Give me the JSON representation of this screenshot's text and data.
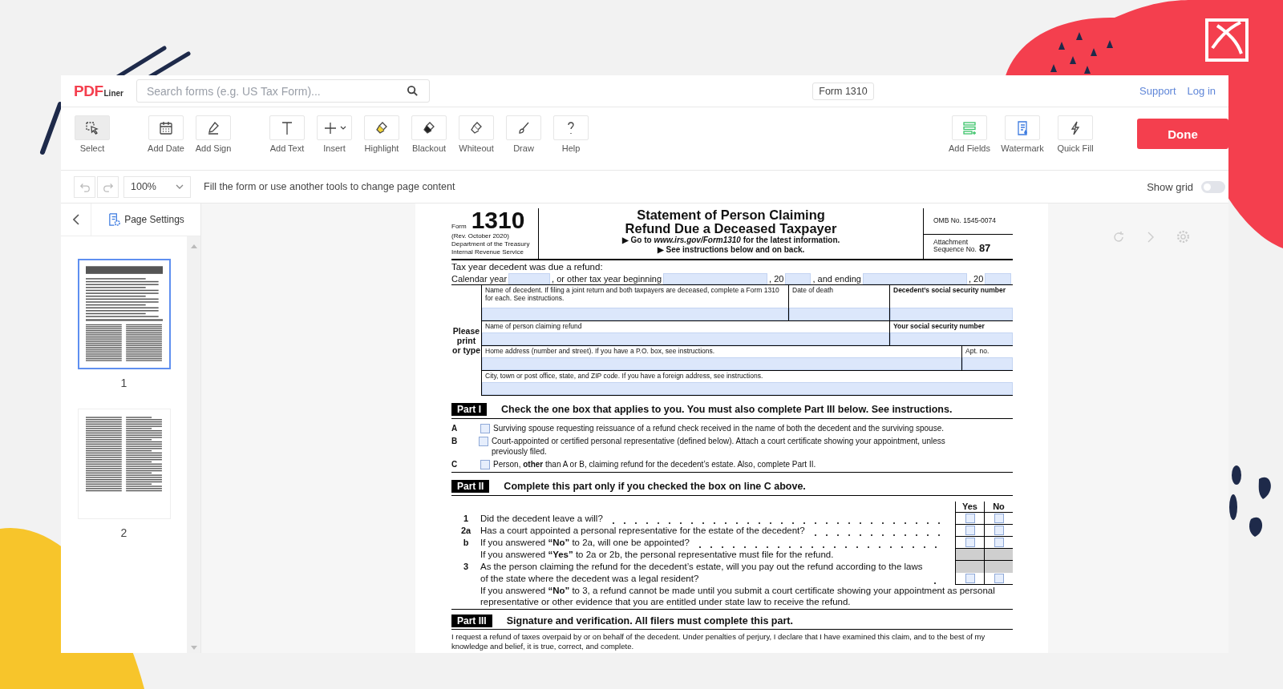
{
  "header": {
    "logo_main": "PDF",
    "logo_sub": "Liner",
    "search": {
      "placeholder": "Search forms (e.g. US Tax Form)..."
    },
    "document_title": "Form 1310",
    "links": [
      "Support",
      "Log in"
    ]
  },
  "toolbar": {
    "tool_groups": [
      [
        {
          "label": "Select",
          "kind": "select",
          "selected": true
        }
      ],
      [
        {
          "label": "Add Date",
          "kind": "calendar",
          "selected": false
        },
        {
          "label": "Add Sign",
          "kind": "sign",
          "selected": false
        }
      ],
      [
        {
          "label": "Add Text",
          "kind": "text",
          "selected": false
        },
        {
          "label": "Insert",
          "kind": "plus",
          "selected": false
        },
        {
          "label": "Highlight",
          "kind": "highlight",
          "selected": false
        },
        {
          "label": "Blackout",
          "kind": "blackout",
          "selected": false
        },
        {
          "label": "Whiteout",
          "kind": "whiteout",
          "selected": false
        },
        {
          "label": "Draw",
          "kind": "draw",
          "selected": false
        },
        {
          "label": "Help",
          "kind": "help",
          "selected": false
        }
      ]
    ],
    "right_tools": [
      {
        "label": "Add Fields",
        "kind": "fields",
        "selected": false
      },
      {
        "label": "Watermark",
        "kind": "watermark",
        "selected": false
      },
      {
        "label": "Quick Fill",
        "kind": "bolt",
        "selected": false
      }
    ],
    "done": "Done"
  },
  "subbar": {
    "zoom": "100%",
    "hint": "Fill the form or use another tools to change page content",
    "show_grid": {
      "label": "Show grid",
      "on": false
    }
  },
  "sidebar": {
    "page_settings": "Page Settings",
    "pages": [
      {
        "number": "1",
        "selected": true
      },
      {
        "number": "2",
        "selected": false
      }
    ]
  },
  "form": {
    "form_label": "Form",
    "number": "1310",
    "revision": "(Rev. October 2020)",
    "department": "Department of the Treasury",
    "service": "Internal Revenue Service",
    "title_lines": [
      "Statement of Person Claiming",
      "Refund Due a Deceased Taxpayer"
    ],
    "instructions": [
      "▶ Go to *www.irs.gov/Form1310* for the latest information.",
      "▶ See instructions below and on back."
    ],
    "omb": "OMB No. 1545-0074",
    "attachment": "Attachment",
    "sequence_label": "Sequence No.",
    "sequence": "87",
    "tax_year_heading": "Tax year decedent was due a refund:",
    "tax_year_labels": [
      "Calendar year",
      ", or other tax year beginning",
      ", 20",
      ", and ending",
      ", 20"
    ],
    "side_label": "Please print or type",
    "rows": [
      [
        {
          "label": "Name of decedent. If filing a joint return and both taxpayers are deceased, complete a Form 1310 for each. See instructions."
        },
        {
          "label": "Date of death"
        },
        {
          "label": "Decedent’s social security number"
        }
      ],
      [
        {
          "label": "Name of person claiming refund"
        },
        {
          "label": "Your social security number"
        }
      ],
      [
        {
          "label": "Home address (number and street). If you have a P.O. box, see instructions."
        },
        {
          "label": "Apt. no."
        }
      ],
      [
        {
          "label": "City, town or post office, state, and ZIP code. If you have a foreign address, see instructions."
        }
      ]
    ],
    "part1": {
      "tag": "Part I",
      "heading": "Check the one box that applies to you.  You must also complete Part III below.  See instructions.",
      "options": [
        {
          "letter": "A",
          "text": "Surviving spouse requesting reissuance of a refund check received in the name of both the decedent and the surviving spouse.",
          "checked": false
        },
        {
          "letter": "B",
          "text": "Court-appointed or certified personal representative (defined below). Attach a court certificate showing your appointment, unless previously filed.",
          "checked": false
        },
        {
          "letter": "C",
          "text": "Person, **other** than A or B, claiming refund for the decedent’s estate. Also, complete Part II.",
          "checked": false
        }
      ]
    },
    "part2": {
      "tag": "Part II",
      "heading": "Complete this part only if you checked the box on line C above.",
      "columns": [
        "Yes",
        "No"
      ],
      "questions": [
        {
          "kind": "question",
          "number": "1",
          "text": "Did the decedent leave a will?",
          "yes": false,
          "no": false
        },
        {
          "kind": "question",
          "number": "2a",
          "text": "Has a court appointed a personal representative for the estate of the decedent?",
          "yes": false,
          "no": false
        },
        {
          "kind": "question",
          "number": "b",
          "text": "If you answered **“No”** to 2a, will one be appointed?",
          "yes": false,
          "no": false
        },
        {
          "kind": "note",
          "text": "If you answered **“Yes”** to 2a or 2b, the personal representative must file for the refund."
        },
        {
          "kind": "question",
          "number": "3",
          "text": "As the person claiming the refund for the decedent’s estate, will you pay out the refund according to the laws of the state where the decedent was a legal resident?",
          "yes": false,
          "no": false
        },
        {
          "kind": "footnote",
          "text": "If you answered **“No”** to 3, a refund cannot be made until you submit a court certificate showing your appointment as personal representative or other evidence that you are entitled under state law to receive the refund."
        }
      ]
    },
    "part3": {
      "tag": "Part III",
      "heading": "Signature and verification. All filers must complete this part.",
      "text": "I request a refund of taxes overpaid by or on behalf of the decedent. Under penalties of perjury, I declare that I have examined this claim, and to the best of my knowledge and belief, it is true, correct, and complete."
    }
  }
}
